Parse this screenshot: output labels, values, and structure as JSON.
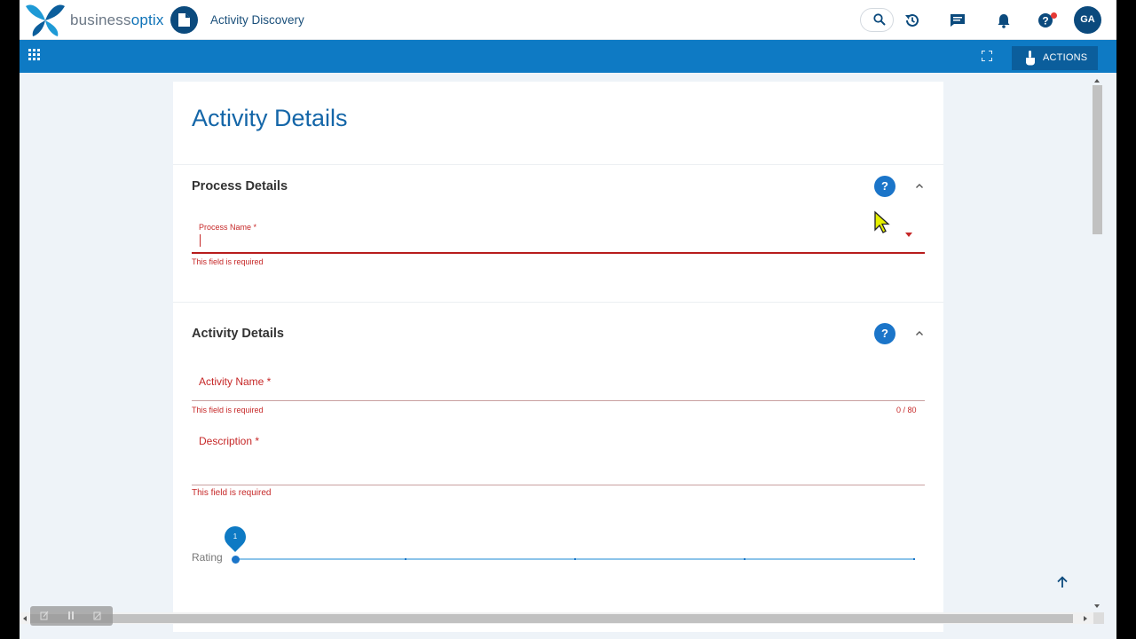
{
  "header": {
    "brand_prefix": "business",
    "brand_suffix": "optix",
    "app_title": "Activity Discovery",
    "avatar_initials": "GA",
    "icons": [
      "search-icon",
      "history-icon",
      "chat-icon",
      "bell-icon",
      "help-icon"
    ]
  },
  "toolbar": {
    "actions_label": "ACTIONS",
    "icons": [
      "apps-grid-icon",
      "fullscreen-icon",
      "hand-pointer-icon"
    ]
  },
  "page": {
    "title": "Activity Details"
  },
  "process_section": {
    "title": "Process Details",
    "help": "?",
    "process_name": {
      "label": "Process Name *",
      "value": "",
      "error": "This field is required"
    }
  },
  "activity_section": {
    "title": "Activity Details",
    "help": "?",
    "activity_name": {
      "label": "Activity Name *",
      "value": "",
      "error": "This field is required",
      "counter": "0 / 80"
    },
    "description": {
      "label": "Description *",
      "value": "",
      "error": "This field is required"
    },
    "rating": {
      "label": "Rating",
      "value": "1",
      "min": 1,
      "max": 5
    }
  },
  "colors": {
    "primary": "#0e7ac4",
    "title_blue": "#1466a8",
    "error": "#c62828",
    "navy": "#0b4a7d"
  }
}
